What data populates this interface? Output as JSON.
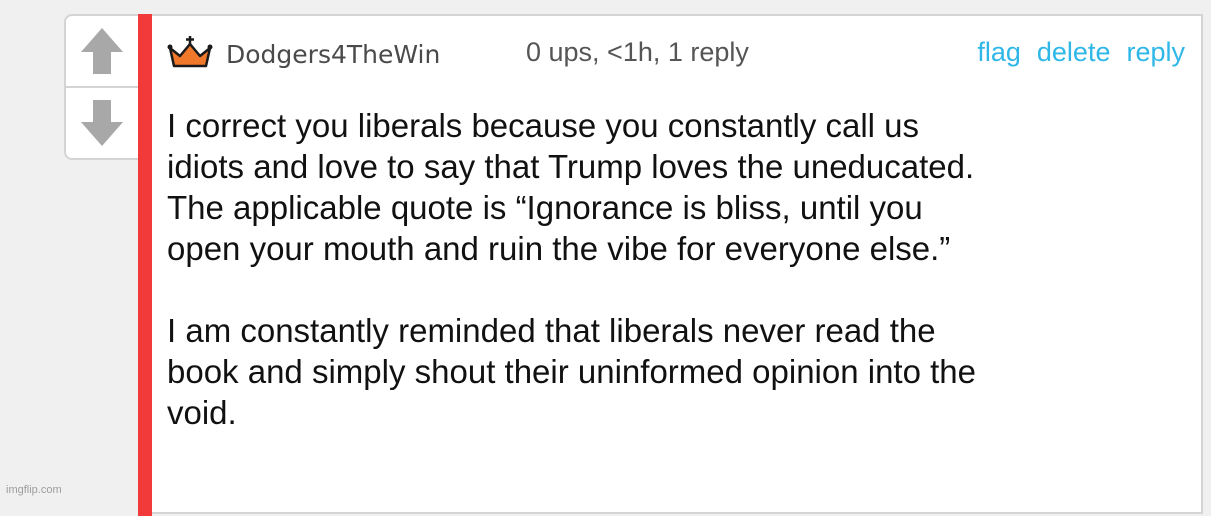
{
  "votes": {
    "upvote_icon": "arrow-up-icon",
    "downvote_icon": "arrow-down-icon",
    "arrow_color": "#a8a8a8"
  },
  "comment": {
    "accent_color": "#f33a3a",
    "badge_icon": "crown-icon",
    "badge_color": "#f0782a",
    "username": "Dodgers4TheWin",
    "meta": "0 ups, <1h, 1 reply",
    "actions": {
      "flag": "flag",
      "delete": "delete",
      "reply": "reply"
    },
    "action_color": "#2fb7e8",
    "paragraphs": [
      {
        "lines": [
          "I correct you liberals because you constantly call us",
          "idiots and love to say that Trump loves the uneducated.",
          "The applicable quote is “Ignorance is bliss, until you",
          "open your mouth and ruin the vibe for everyone else.”"
        ]
      },
      {
        "lines": [
          "I am constantly reminded that liberals never read the",
          "book and simply shout their uninformed opinion into the",
          "void."
        ]
      }
    ]
  },
  "watermark": "imgflip.com"
}
